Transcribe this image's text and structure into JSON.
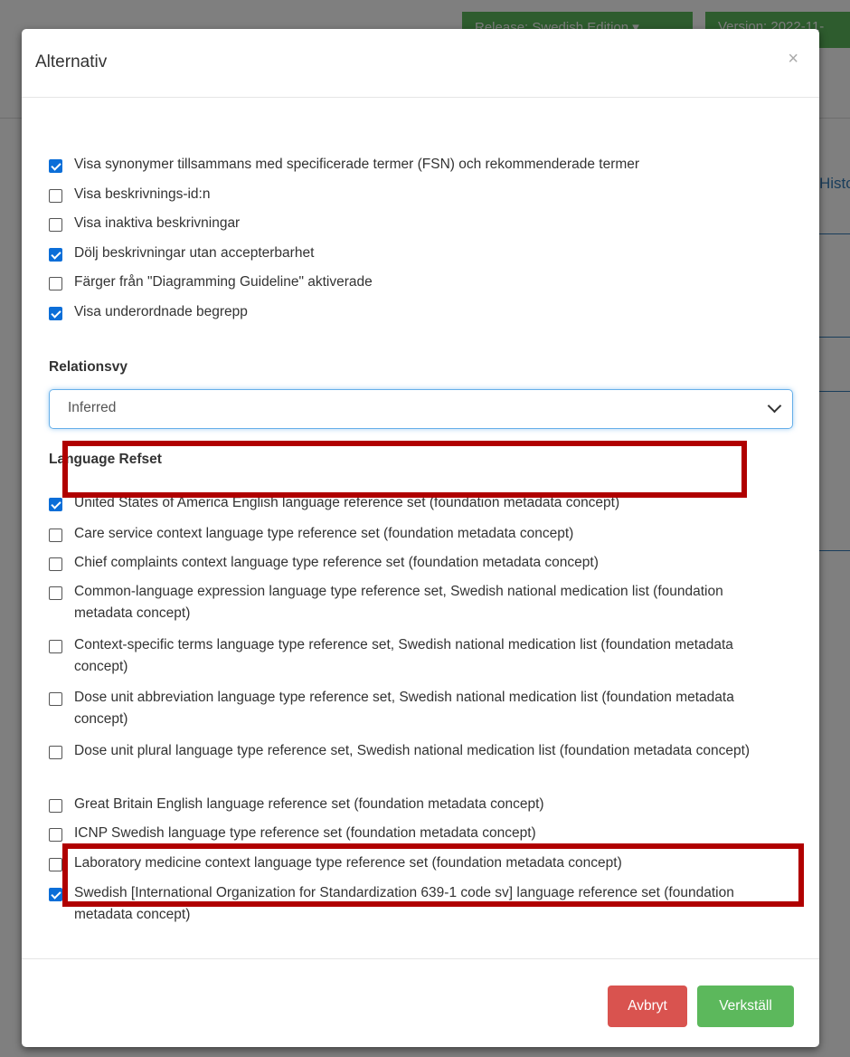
{
  "background": {
    "release_button": "Release: Swedish Edition ▾",
    "version_button": "Version: 2022-11-",
    "history_tab": "Histo"
  },
  "modal": {
    "title": "Alternativ",
    "close_icon": "×",
    "display_options": [
      {
        "label": "Visa synonymer tillsammans med specificerade termer (FSN) och rekommenderade termer",
        "checked": true
      },
      {
        "label": "Visa beskrivnings-id:n",
        "checked": false
      },
      {
        "label": "Visa inaktiva beskrivningar",
        "checked": false
      },
      {
        "label": "Dölj beskrivningar utan accepterbarhet",
        "checked": true
      },
      {
        "label": "Färger från \"Diagramming Guideline\" aktiverade",
        "checked": false
      },
      {
        "label": "Visa underordnade begrepp",
        "checked": true
      }
    ],
    "relations_label": "Relationsvy",
    "relations_value": "Inferred",
    "language_refset_label": "Language Refset",
    "language_refsets": [
      {
        "label": "United States of America English language reference set (foundation metadata concept)",
        "checked": true
      },
      {
        "label": "Care service context language type reference set (foundation metadata concept)",
        "checked": false
      },
      {
        "label": "Chief complaints context language type reference set (foundation metadata concept)",
        "checked": false
      },
      {
        "label": "Common-language expression language type reference set, Swedish national medication list (foundation metadata concept)",
        "checked": false
      },
      {
        "label": "Context-specific terms language type reference set, Swedish national medication list (foundation metadata concept)",
        "checked": false
      },
      {
        "label": "Dose unit abbreviation language type reference set, Swedish national medication list (foundation metadata concept)",
        "checked": false
      },
      {
        "label": "Dose unit plural language type reference set, Swedish national medication list (foundation metadata concept)",
        "checked": false
      },
      {
        "label": "Great Britain English language reference set (foundation metadata concept)",
        "checked": false
      },
      {
        "label": "ICNP Swedish language type reference set (foundation metadata concept)",
        "checked": false
      },
      {
        "label": "Laboratory medicine context language type reference set (foundation metadata concept)",
        "checked": false
      },
      {
        "label": "Swedish [International Organization for Standardization 639-1 code sv] language reference set (foundation metadata concept)",
        "checked": true
      }
    ],
    "cancel_label": "Avbryt",
    "apply_label": "Verkställ"
  },
  "colors": {
    "highlight": "#b00000",
    "checkbox_checked": "#0b6ed8",
    "cancel": "#d9534f",
    "apply": "#5cb85c"
  }
}
